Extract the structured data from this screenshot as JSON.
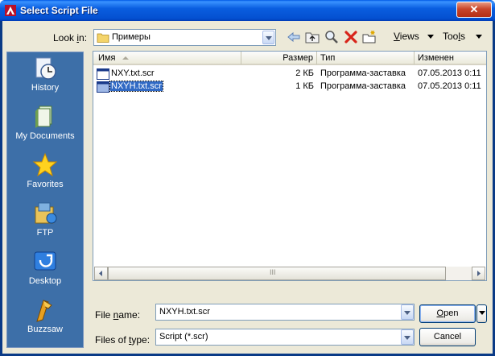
{
  "window": {
    "title": "Select Script File",
    "close_glyph": "✕"
  },
  "lookin": {
    "label_pre": "Look ",
    "label_key": "i",
    "label_post": "n:",
    "value": "Примеры"
  },
  "toolbar": {
    "icons": [
      "back-arrow-icon",
      "up-folder-icon",
      "search-web-icon",
      "delete-icon",
      "new-folder-icon"
    ],
    "views_pre": "",
    "views_key": "V",
    "views_post": "iews",
    "tools_pre": "Too",
    "tools_key": "l",
    "tools_post": "s"
  },
  "places": [
    {
      "label": "History",
      "icon": "history-icon"
    },
    {
      "label": "My Documents",
      "icon": "my-documents-icon"
    },
    {
      "label": "Favorites",
      "icon": "favorites-star-icon"
    },
    {
      "label": "FTP",
      "icon": "ftp-icon"
    },
    {
      "label": "Desktop",
      "icon": "desktop-icon"
    },
    {
      "label": "Buzzsaw",
      "icon": "buzzsaw-icon"
    }
  ],
  "columns": {
    "name": "Имя",
    "size": "Размер",
    "type": "Тип",
    "modified": "Изменен"
  },
  "files": [
    {
      "name": "NXY.txt.scr",
      "size": "2 КБ",
      "type": "Программа-заставка",
      "modified": "07.05.2013 0:11"
    },
    {
      "name": "NXYH.txt.scr",
      "size": "1 КБ",
      "type": "Программа-заставка",
      "modified": "07.05.2013 0:11"
    }
  ],
  "scrollbar": {
    "grip": "III"
  },
  "filename": {
    "label_pre": "File ",
    "label_key": "n",
    "label_post": "ame:",
    "value": "NXYH.txt.scr"
  },
  "filetype": {
    "label_pre": "Files of ",
    "label_key": "t",
    "label_post": "ype:",
    "value": "Script (*.scr)"
  },
  "buttons": {
    "open_key": "O",
    "open_rest": "pen",
    "cancel": "Cancel"
  }
}
